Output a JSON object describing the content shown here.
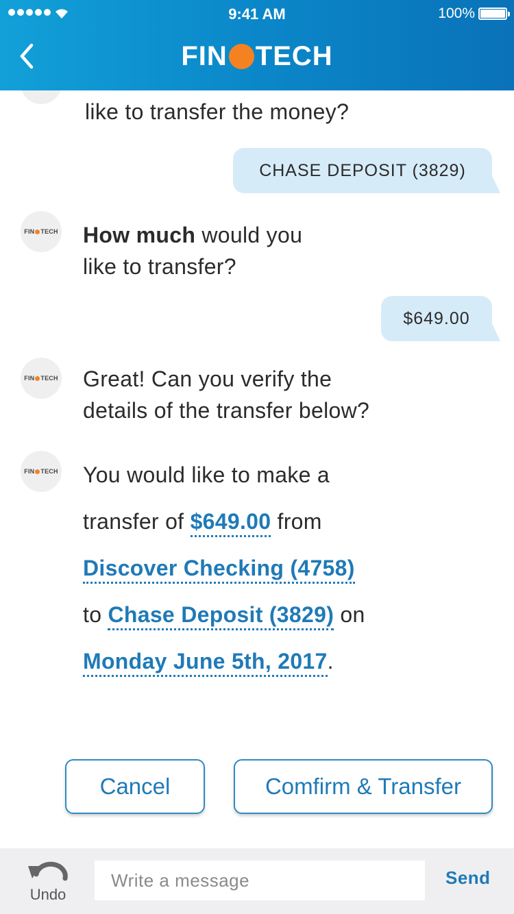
{
  "status_bar": {
    "time": "9:41 AM",
    "battery": "100%"
  },
  "header": {
    "logo_left": "FIN",
    "logo_right": "TECH",
    "back_icon": "chevron-left-icon"
  },
  "avatar": {
    "left": "FIN",
    "right": "TECH"
  },
  "messages": {
    "partial_bot": "like to transfer the money?",
    "user_account": "CHASE DEPOSIT (3829)",
    "bot_amount_bold": "How much",
    "bot_amount_rest": " would you",
    "bot_amount_line2": "like to transfer?",
    "user_amount": "$649.00",
    "bot_verify_line1": "Great! Can you verify the",
    "bot_verify_line2": "details of the transfer below?"
  },
  "summary": {
    "line1": "You would like to make a",
    "transfer_of": "transfer of ",
    "amount": "$649.00",
    "from": " from",
    "from_account": "Discover Checking (4758)",
    "to": "to ",
    "to_account": "Chase Deposit (3829)",
    "on": " on",
    "date": "Monday June 5th, 2017",
    "period": "."
  },
  "actions": {
    "cancel": "Cancel",
    "confirm": "Comfirm & Transfer"
  },
  "composer": {
    "undo": "Undo",
    "placeholder": "Write a message",
    "send": "Send"
  },
  "colors": {
    "header_start": "#12a0d8",
    "header_end": "#0a72b8",
    "accent": "#1f7ab7",
    "logo_dot": "#f58220",
    "user_bubble": "#d6ebf8"
  }
}
